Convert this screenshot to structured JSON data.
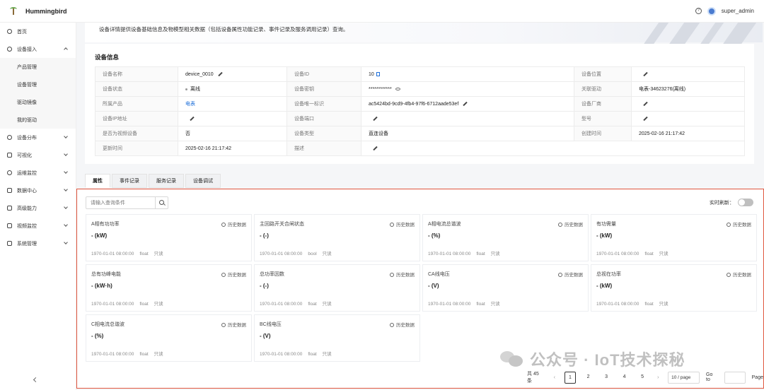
{
  "app": {
    "title": "Hummingbird",
    "user": "super_admin"
  },
  "sidebar": {
    "items": [
      {
        "label": "首页"
      },
      {
        "label": "设备接入",
        "expanded": true
      },
      {
        "label": "设备分布"
      },
      {
        "label": "可视化"
      },
      {
        "label": "运维监控"
      },
      {
        "label": "数据中心"
      },
      {
        "label": "高级能力"
      },
      {
        "label": "视频监控"
      },
      {
        "label": "系统管理"
      }
    ],
    "submenu": [
      {
        "label": "产品管理"
      },
      {
        "label": "设备管理"
      },
      {
        "label": "驱动镜像"
      },
      {
        "label": "我的驱动"
      }
    ]
  },
  "description": "设备详情提供设备基础信息及物模型相关数据（包括设备属性功能记录、事件记录及服务调用记录）查询。",
  "device_info": {
    "title": "设备信息",
    "rows": [
      [
        {
          "label": "设备名称",
          "value": "device_0010"
        },
        {
          "label": "设备ID",
          "value": "10"
        },
        {
          "label": "设备位置",
          "value": ""
        }
      ],
      [
        {
          "label": "设备状态",
          "value": "离线"
        },
        {
          "label": "设备密钥",
          "value": "************"
        },
        {
          "label": "关联驱动",
          "value": "电表-34623276(离线)"
        }
      ],
      [
        {
          "label": "所属产品",
          "value": "电表"
        },
        {
          "label": "设备唯一标识",
          "value": "ac5424bd-9cd9-4fb4-97f6-6712aade53ef"
        },
        {
          "label": "设备厂商",
          "value": ""
        }
      ],
      [
        {
          "label": "设备IP地址",
          "value": ""
        },
        {
          "label": "设备端口",
          "value": ""
        },
        {
          "label": "型号",
          "value": ""
        }
      ],
      [
        {
          "label": "是否为视频设备",
          "value": "否"
        },
        {
          "label": "设备类型",
          "value": "直连设备"
        },
        {
          "label": "创建时间",
          "value": "2025-02-16 21:17:42"
        }
      ],
      [
        {
          "label": "更新时间",
          "value": "2025-02-16 21:17:42"
        },
        {
          "label": "描述",
          "value": ""
        }
      ]
    ]
  },
  "tabs": [
    {
      "label": "属性"
    },
    {
      "label": "事件记录"
    },
    {
      "label": "服务记录"
    },
    {
      "label": "设备调试"
    }
  ],
  "properties": {
    "search_placeholder": "请输入查询条件",
    "realtime_label": "实时刷新：",
    "history_label": "历史数据",
    "access_label": "只读",
    "items": [
      {
        "name": "A相有功功率",
        "value": "- (kW)",
        "time": "1970-01-01 08:00:00",
        "type": "float"
      },
      {
        "name": "主回路开关合闸状态",
        "value": "- (-)",
        "time": "1970-01-01 08:00:00",
        "type": "bool"
      },
      {
        "name": "A相电流总谐波",
        "value": "- (%)",
        "time": "1970-01-01 08:00:00",
        "type": "float"
      },
      {
        "name": "有功需量",
        "value": "- (kW)",
        "time": "1970-01-01 08:00:00",
        "type": "float"
      },
      {
        "name": "总有功峰电能",
        "value": "- (kW·h)",
        "time": "1970-01-01 08:00:00",
        "type": "float"
      },
      {
        "name": "总功率因数",
        "value": "- (-)",
        "time": "1970-01-01 08:00:00",
        "type": "float"
      },
      {
        "name": "CA线电压",
        "value": "- (V)",
        "time": "1970-01-01 08:00:00",
        "type": "float"
      },
      {
        "name": "总视在功率",
        "value": "- (kW)",
        "time": "1970-01-01 08:00:00",
        "type": "float"
      },
      {
        "name": "C相电流总谐波",
        "value": "- (%)",
        "time": "1970-01-01 08:00:00",
        "type": "float"
      },
      {
        "name": "BC线电压",
        "value": "- (V)",
        "time": "1970-01-01 08:00:00",
        "type": "float"
      }
    ]
  },
  "pagination": {
    "total": "共 45 条",
    "pages": [
      "1",
      "2",
      "3",
      "4",
      "5"
    ],
    "current": "1",
    "page_size": "10 / page",
    "goto_label": "Go to",
    "page_label": "Page"
  },
  "watermark": "公众号 · IoT技术探秘"
}
